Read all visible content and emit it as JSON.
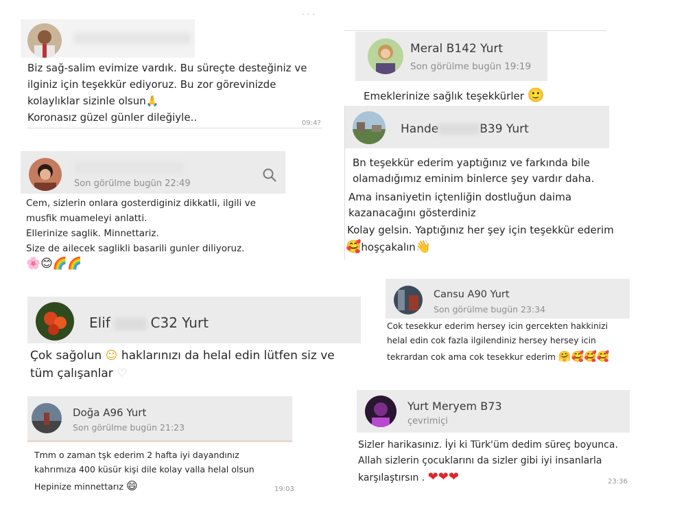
{
  "top_dots": "· · ·",
  "chats": {
    "c1": {
      "lines": [
        "Biz sağ-salim evimize vardık. Bu süreçte desteğiniz ve",
        "ilginiz için teşekkür ediyoruz. Bu zor görevinizde",
        "kolaylıklar sizinle olsun",
        "Koronasız güzel günler dileğiyle.."
      ],
      "emoji": "🙏",
      "time": "09:4?"
    },
    "c2": {
      "status": "Son görülme bugün 22:49",
      "lines": [
        "Cem, sizlerin onlara gosterdiginiz dikkatli, ilgili ve",
        "musfik muameleyi anlatti.",
        "Ellerinize saglik. Minnettariz.",
        "Size de ailecek saglikli basarili gunler diliyoruz."
      ],
      "emojis": "🌸😊🌈🌈"
    },
    "c3": {
      "name_first": "Elif",
      "name_last": "C32 Yurt",
      "lines": [
        "Çok sağolun",
        "haklarınızı  da helal edin lütfen  siz ve",
        "tüm çalışanlar"
      ],
      "emoji_a": "☺",
      "emoji_b": "♡"
    },
    "c4": {
      "name": "Doğa A96 Yurt",
      "status": "Son görülme bugün 21:23",
      "lines": [
        "Tmm o zaman tşk ederim 2 hafta iyi dayandınız",
        "kahrımıza 400 küsür kişi dile kolay valla helal olsun",
        "Hepinize minnettarız"
      ],
      "emoji": "😄",
      "time": "19:03"
    },
    "c5": {
      "name": "Meral B142 Yurt",
      "status": "Son görülme bugün 19:19",
      "line": "Emeklerinize sağlık teşekkürler",
      "emoji": "🙂"
    },
    "c6": {
      "name_first": "Hande",
      "name_last": "B39 Yurt",
      "lines": [
        "Bn teşekkür ederim yaptığınız ve farkında bile",
        "olamadığımız eminim binlerce şey vardır daha.",
        "Ama insaniyetin içtenliğin dostluğun daima",
        "kazanacağını gösterdiniz",
        "Kolay gelsin. Yaptığınız her şey için teşekkür ederim",
        "hoşçakalın"
      ],
      "emoji_a": "🥰",
      "emoji_b": "👋"
    },
    "c7": {
      "name": "Cansu A90 Yurt",
      "status": "Son görülme bugün 23:34",
      "lines": [
        "Cok tesekkur ederim hersey icin gercekten hakkinizi",
        "helal edin cok fazla ilgilendiniz hersey hersey icin",
        "tekrardan cok ama cok tesekkur ederim"
      ],
      "emojis": "🤗🥰🥰🥰"
    },
    "c8": {
      "name": "Yurt Meryem B73",
      "status": "çevrimiçi",
      "lines": [
        "Sizler harikasınız. İyi ki Türk'üm dedim süreç boyunca.",
        "Allah sizlerin çocuklarını da sizler gibi iyi insanlarla",
        "karşılaştırsın ."
      ],
      "hearts": "❤❤❤",
      "time": "23:36"
    }
  },
  "colors": {
    "header_bg": "#ebebeb",
    "heart": "#e0262f",
    "muted": "#8d8d8d"
  }
}
